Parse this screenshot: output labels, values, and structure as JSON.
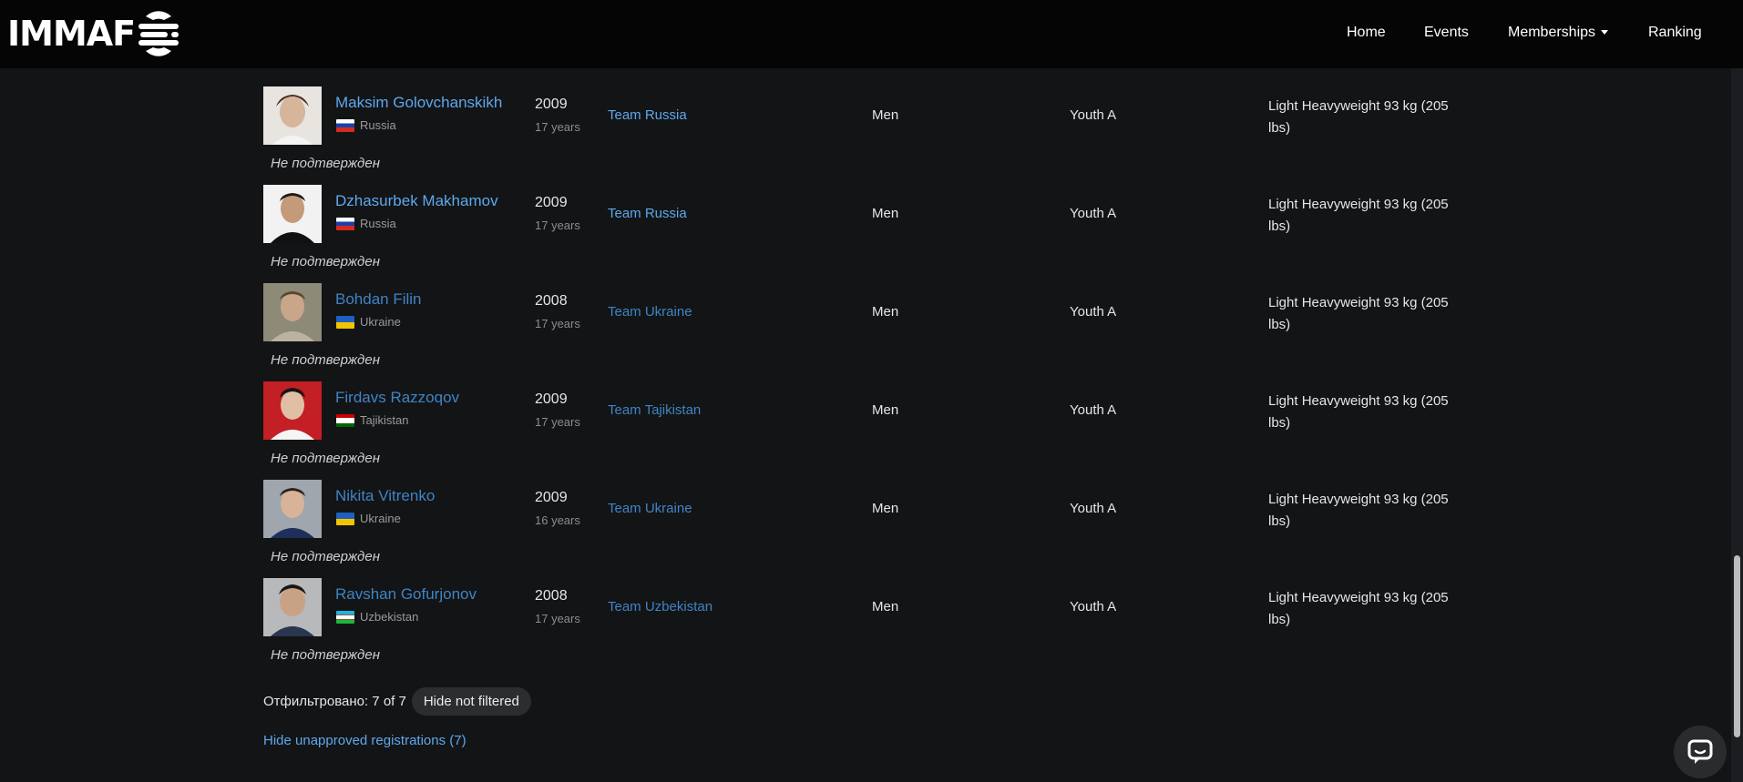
{
  "header": {
    "logo_text": "IMMAF",
    "nav": [
      {
        "label": "Home",
        "dropdown": false
      },
      {
        "label": "Events",
        "dropdown": false
      },
      {
        "label": "Memberships",
        "dropdown": true
      },
      {
        "label": "Ranking",
        "dropdown": false
      }
    ]
  },
  "athletes": [
    {
      "name": "Maksim Golovchanskikh",
      "country": "Russia",
      "flag": "russia-flag-icon",
      "year": "2009",
      "age": "17 years",
      "team": "Team Russia",
      "gender": "Men",
      "category": "Youth A",
      "weight": "Light Heavyweight 93 kg (205 lbs)",
      "status": "Не подтвержден"
    },
    {
      "name": "Dzhasurbek Makhamov",
      "country": "Russia",
      "flag": "russia-flag-icon",
      "year": "2009",
      "age": "17 years",
      "team": "Team Russia",
      "gender": "Men",
      "category": "Youth A",
      "weight": "Light Heavyweight 93 kg (205 lbs)",
      "status": "Не подтвержден"
    },
    {
      "name": "Bohdan Filin",
      "country": "Ukraine",
      "flag": "ukraine-flag-icon",
      "year": "2008",
      "age": "17 years",
      "team": "Team Ukraine",
      "gender": "Men",
      "category": "Youth A",
      "weight": "Light Heavyweight 93 kg (205 lbs)",
      "status": "Не подтвержден"
    },
    {
      "name": "Firdavs Razzoqov",
      "country": "Tajikistan",
      "flag": "tajikistan-flag-icon",
      "year": "2009",
      "age": "17 years",
      "team": "Team Tajikistan",
      "gender": "Men",
      "category": "Youth A",
      "weight": "Light Heavyweight 93 kg (205 lbs)",
      "status": "Не подтвержден"
    },
    {
      "name": "Nikita Vitrenko",
      "country": "Ukraine",
      "flag": "ukraine-flag-icon",
      "year": "2009",
      "age": "16 years",
      "team": "Team Ukraine",
      "gender": "Men",
      "category": "Youth A",
      "weight": "Light Heavyweight 93 kg (205 lbs)",
      "status": "Не подтвержден"
    },
    {
      "name": "Ravshan Gofurjonov",
      "country": "Uzbekistan",
      "flag": "uzbekistan-flag-icon",
      "year": "2008",
      "age": "17 years",
      "team": "Team Uzbekistan",
      "gender": "Men",
      "category": "Youth A",
      "weight": "Light Heavyweight 93 kg (205 lbs)",
      "status": "Не подтвержден"
    }
  ],
  "footer": {
    "filtered_label": "Отфильтровано: 7 of 7",
    "hide_not_filtered": "Hide not filtered",
    "hide_unapproved": "Hide unapproved registrations (7)"
  },
  "colors": {
    "link": "#5ea8ec",
    "link_dim": "#3f84c4",
    "background": "#131416",
    "header": "#050505"
  },
  "icons": {
    "chat": "chat-bubble-icon"
  }
}
